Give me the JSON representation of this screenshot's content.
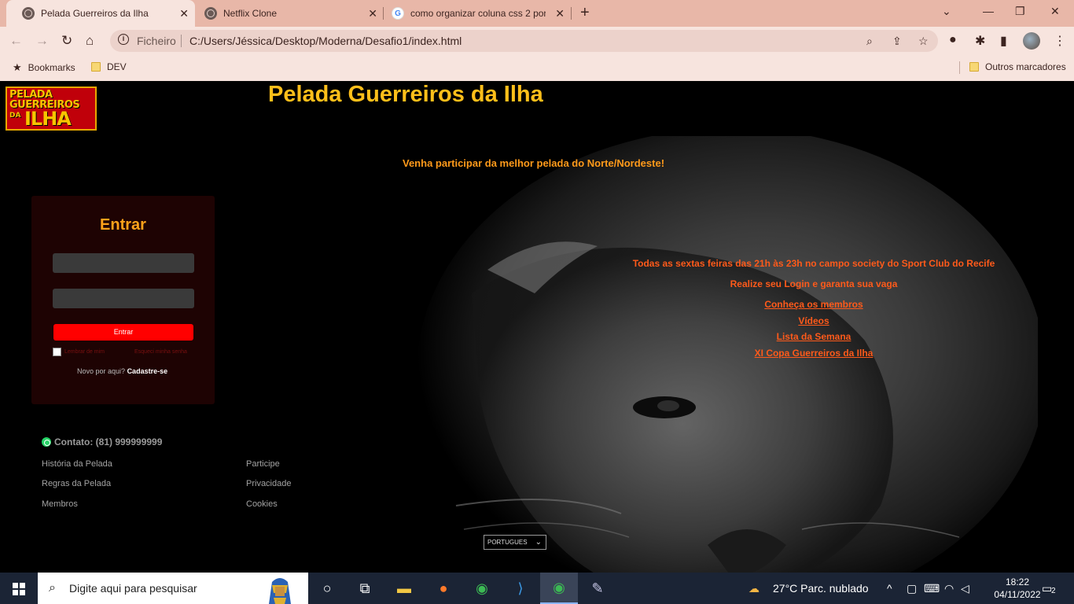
{
  "browser": {
    "tabs": [
      {
        "title": "Pelada Guerreiros da Ilha",
        "active": true
      },
      {
        "title": "Netflix Clone",
        "active": false
      },
      {
        "title": "como organizar coluna css 2 por",
        "active": false
      }
    ],
    "close_glyph": "✕",
    "new_tab_glyph": "+",
    "address": {
      "scheme_label": "Ficheiro",
      "url": "C:/Users/Jéssica/Desktop/Moderna/Desafio1/index.html"
    },
    "bookmarks": {
      "bookmarks_label": "Bookmarks",
      "dev_folder": "DEV",
      "other_folder": "Outros marcadores"
    }
  },
  "site": {
    "logo_text": {
      "line1": "PELADA",
      "line2": "GUERREIROS",
      "line3": "DA",
      "line4": "ILHA"
    },
    "title": "Pelada Guerreiros da Ilha",
    "tagline": "Venha participar da melhor pelada do Norte/Nordeste!",
    "login": {
      "heading": "Entrar",
      "button": "Entrar",
      "remember": "Lembrar de mim",
      "forgot": "Esqueci minha senha",
      "new_here": "Novo por aqui?",
      "signup": "Cadastre-se"
    },
    "info": {
      "schedule": "Todas as sextas feiras das 21h às 23h no campo society do Sport Club do Recife",
      "cta": "Realize seu Login e garanta sua vaga",
      "links": [
        "Conheça os membros",
        "Vídeos",
        "Lista da Semana",
        "XI Copa Guerreiros da Ilha"
      ]
    },
    "footer": {
      "contact": "Contato: (81) 999999999",
      "col1": [
        "História da Pelada",
        "Regras da Pelada",
        "Membros"
      ],
      "col2": [
        "Participe",
        "Privacidade",
        "Cookies"
      ],
      "language": "PORTUGUES"
    }
  },
  "taskbar": {
    "search_placeholder": "Digite aqui para pesquisar",
    "weather": "27°C  Parc. nublado",
    "time": "18:22",
    "date": "04/11/2022",
    "notifications": "2"
  },
  "colors": {
    "accent_yellow": "#ffbf1a",
    "accent_orange": "#ff5a1a",
    "login_bg": "#1e0303",
    "button_red": "#ff0000"
  }
}
